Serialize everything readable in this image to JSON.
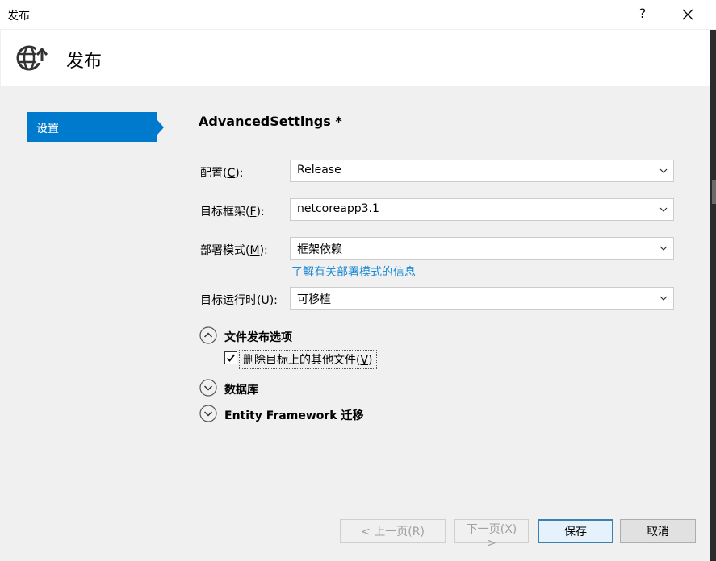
{
  "window": {
    "title": "发布",
    "help_label": "?"
  },
  "header": {
    "title": "发布",
    "icon": "globe-publish-icon"
  },
  "nav": {
    "items": [
      {
        "label": "设置",
        "selected": true
      }
    ]
  },
  "settings": {
    "title": "AdvancedSettings *",
    "config": {
      "label": "配置(",
      "key": "C",
      "suffix": "):",
      "value": "Release"
    },
    "framework": {
      "label": "目标框架(",
      "key": "F",
      "suffix": "):",
      "value": "netcoreapp3.1"
    },
    "deploy": {
      "label": "部署模式(",
      "key": "M",
      "suffix": "):",
      "value": "框架依赖",
      "link": "了解有关部署模式的信息"
    },
    "runtime": {
      "label": "目标运行时(",
      "key": "U",
      "suffix": "):",
      "value": "可移植"
    }
  },
  "sections": {
    "file_options": {
      "label": "文件发布选项",
      "expanded": true,
      "delete_files": {
        "label": "删除目标上的其他文件(",
        "key": "V",
        "suffix": ")",
        "checked": true
      }
    },
    "database": {
      "label": "数据库",
      "expanded": false
    },
    "ef": {
      "label": "Entity Framework 迁移",
      "expanded": false
    }
  },
  "buttons": {
    "prev": {
      "label": "< 上一页(R)",
      "enabled": false
    },
    "next": {
      "label": "下一页(X) >",
      "enabled": false
    },
    "save": {
      "label": "保存",
      "enabled": true
    },
    "cancel": {
      "label": "取消",
      "enabled": true
    }
  },
  "colors": {
    "accent": "#007acc",
    "link": "#1b8ad6"
  }
}
